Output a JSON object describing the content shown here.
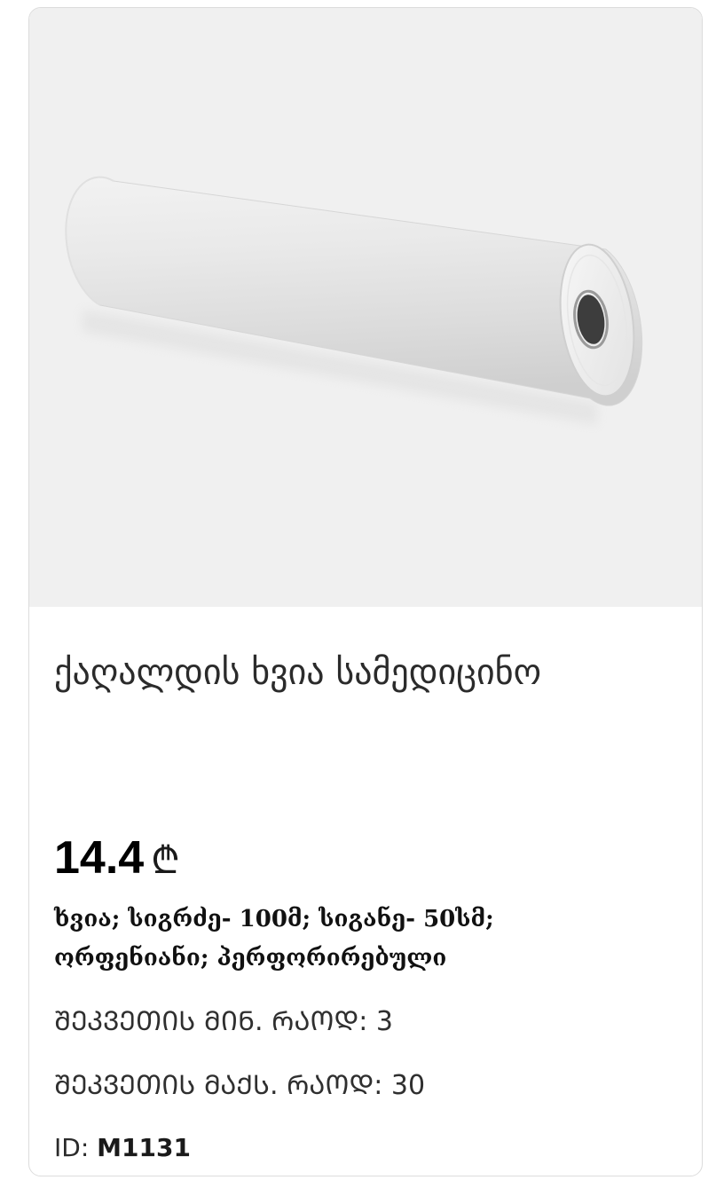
{
  "product": {
    "title": "ქაღალდის ხვია სამედიცინო",
    "price": "14.4",
    "currency_symbol": "₾",
    "description": "ხვია; სიგრძე- 100მ; სიგანე- 50სმ; ორფენიანი; პერფორირებული",
    "min_order_label": "ᲨᲔᲙᲕᲔᲗᲘᲡ ᲛᲘᲜ. ᲠᲐᲝᲓ:",
    "min_order_value": "3",
    "max_order_label": "ᲨᲔᲙᲕᲔᲗᲘᲡ ᲛᲐᲥᲡ. ᲠᲐᲝᲓ:",
    "max_order_value": "30",
    "id_label": "ID:",
    "id_value": "M1131",
    "image_icon": "paper-roll-image"
  },
  "colors": {
    "image_background": "#f0f0f0",
    "card_border": "#dcdcdc"
  }
}
